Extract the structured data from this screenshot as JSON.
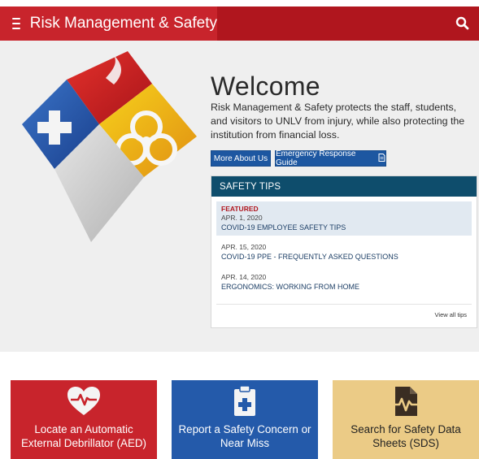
{
  "header": {
    "site_title": "Risk Management & Safety",
    "icons": {
      "menu": "hamburger-icon",
      "search": "search-icon"
    },
    "colors": {
      "bar": "#b0161e",
      "brand": "#c8242c"
    }
  },
  "hero": {
    "logo_icon": "rms-logo-icon",
    "welcome": "Welcome",
    "intro": "Risk Management & Safety protects the staff, students, and visitors to UNLV from injury, while also protecting the institution from financial loss.",
    "buttons": {
      "about": "More About Us",
      "erg": "Emergency Response Guide"
    }
  },
  "safety_tips": {
    "heading": "SAFETY TIPS",
    "items": [
      {
        "badge": "FEATURED",
        "date": "APR. 1, 2020",
        "title": "COVID-19 EMPLOYEE SAFETY TIPS"
      },
      {
        "date": "APR. 15, 2020",
        "title": "COVID-19 PPE - FREQUENTLY ASKED QUESTIONS"
      },
      {
        "date": "APR. 14, 2020",
        "title": "ERGONOMICS: WORKING FROM HOME"
      }
    ],
    "view_all": "View all tips"
  },
  "cards": [
    {
      "label": "Locate an Automatic External Debrillator (AED)",
      "icon": "heartbeat-icon",
      "color": "#c8242c"
    },
    {
      "label": "Report a Safety Concern or Near Miss",
      "icon": "clipboard-medical-icon",
      "color": "#245aaa"
    },
    {
      "label": "Search for Safety Data Sheets (SDS)",
      "icon": "file-waveform-icon",
      "color": "#ebcb86"
    }
  ]
}
